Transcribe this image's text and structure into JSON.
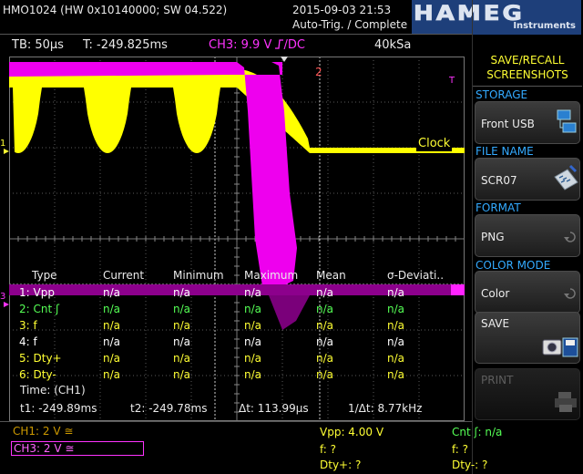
{
  "title": {
    "device": "HMO1024 (HW 0x10140000; SW 04.522)",
    "datetime": "2015-09-03 21:53",
    "status": "Auto-Trig. / Complete",
    "brand": "HAMEG",
    "brand_sub": "Instruments"
  },
  "info": {
    "timebase": "TB: 50µs",
    "trigger_time": "T: -249.825ms",
    "channel": "CH3: 9.9 V",
    "coupling_icon": "rising-edge-icon",
    "coupling": "/DC",
    "sample_rate": "40kSa"
  },
  "markers": {
    "trigger_level": "T",
    "ch1": "1",
    "ch3": "3",
    "ch2": "2",
    "trace_label": "Clock"
  },
  "table": {
    "headers": [
      "Type",
      "Current",
      "Minimum",
      "Maximum",
      "Mean",
      "σ-Deviati.."
    ],
    "rows": [
      {
        "num": "1:",
        "type": "Vpp",
        "cells": [
          "n/a",
          "n/a",
          "n/a",
          "n/a",
          "n/a"
        ],
        "color": "#ffffff"
      },
      {
        "num": "2:",
        "type": "Cnt ʃ",
        "cells": [
          "n/a",
          "n/a",
          "n/a",
          "n/a",
          "n/a"
        ],
        "color": "#55ff55"
      },
      {
        "num": "3:",
        "type": "f",
        "cells": [
          "n/a",
          "n/a",
          "n/a",
          "n/a",
          "n/a"
        ],
        "color": "#ffff33"
      },
      {
        "num": "4:",
        "type": "f",
        "cells": [
          "n/a",
          "n/a",
          "n/a",
          "n/a",
          "n/a"
        ],
        "color": "#ffffff"
      },
      {
        "num": "5:",
        "type": "Dty+",
        "cells": [
          "n/a",
          "n/a",
          "n/a",
          "n/a",
          "n/a"
        ],
        "color": "#ffff33"
      },
      {
        "num": "6:",
        "type": "Dty-",
        "cells": [
          "n/a",
          "n/a",
          "n/a",
          "n/a",
          "n/a"
        ],
        "color": "#ffff33"
      }
    ],
    "time_label": "Time: (CH1)",
    "t1": "t1: -249.89ms",
    "t2": "t2: -249.78ms",
    "dt": "Δt: 113.99µs",
    "inv_dt": "1/Δt: 8.77kHz"
  },
  "sidebar": {
    "title": "SAVE/RECALL\nSCREENSHOTS",
    "storage_label": "STORAGE",
    "storage_value": "Front USB",
    "filename_label": "FILE NAME",
    "filename_value": "SCR07",
    "format_label": "FORMAT",
    "format_value": "PNG",
    "colormode_label": "COLOR MODE",
    "colormode_value": "Color",
    "save_label": "SAVE",
    "print_label": "PRINT"
  },
  "bottom": {
    "ch1": "CH1: 2 V ≅",
    "ch3": "CH3: 2 V ≅",
    "vpp": "Vpp: 4.00 V",
    "cnt": "Cnt ʃ: n/a",
    "f1": "f: ?",
    "f2": "f: ?",
    "dtyp": "Dty+: ?",
    "dtym": "Dty-: ?"
  },
  "colors": {
    "ch1": "#ffff00",
    "ch3": "#ff00ff",
    "accent": "#33aaff",
    "meas_green": "#55ff55"
  }
}
